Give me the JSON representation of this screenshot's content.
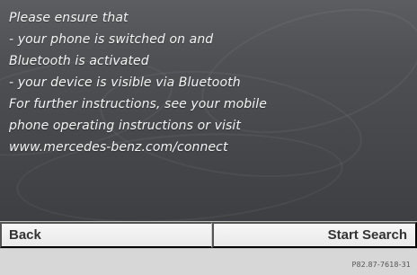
{
  "message": {
    "lines": [
      "Please ensure that",
      " - your phone is switched on and",
      "Bluetooth is activated",
      " - your device is visible via Bluetooth",
      "For further instructions, see your mobile",
      "phone operating instructions or visit",
      "www.mercedes-benz.com/connect"
    ]
  },
  "softkeys": {
    "back_label": "Back",
    "start_search_label": "Start Search"
  },
  "footer": {
    "image_code": "P82.87-7618-31"
  },
  "colors": {
    "panel_background": "#4e5053",
    "message_text": "#f5f5f5",
    "softkey_background": "#ececec",
    "softkey_text": "#333333"
  }
}
